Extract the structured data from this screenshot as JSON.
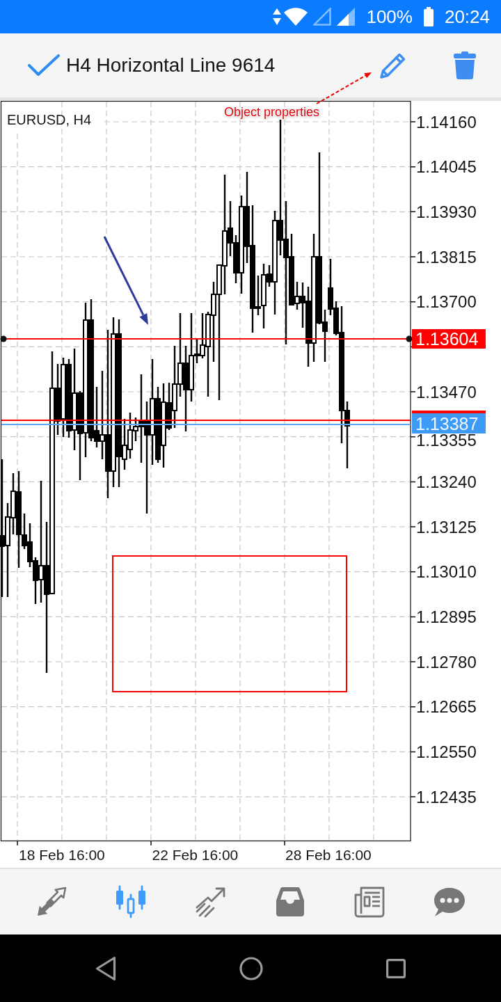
{
  "status_bar": {
    "battery": "100%",
    "time": "20:24"
  },
  "header": {
    "title": "H4 Horizontal Line 9614"
  },
  "callout": {
    "label": "Object properties"
  },
  "chart": {
    "symbol": "EURUSD, H4",
    "horizontal_line": {
      "selected": true
    },
    "price_labels": [
      "1.14160",
      "1.14045",
      "1.13930",
      "1.13815",
      "1.13700",
      "1.13470",
      "1.13355",
      "1.13240",
      "1.13125",
      "1.13010",
      "1.12895",
      "1.12780",
      "1.12665",
      "1.12550",
      "1.12435"
    ],
    "price_tags": [
      {
        "kind": "line",
        "text": "1.13604"
      },
      {
        "kind": "bid",
        "text": "1.13387"
      }
    ],
    "time_labels": [
      "18 Feb 16:00",
      "22 Feb 16:00",
      "28 Feb 16:00"
    ]
  },
  "bottom_nav": [
    {
      "kind": "quotes",
      "selected": false
    },
    {
      "kind": "chart",
      "selected": true
    },
    {
      "kind": "trade",
      "selected": false
    },
    {
      "kind": "history",
      "selected": false
    },
    {
      "kind": "news",
      "selected": false
    },
    {
      "kind": "messages",
      "selected": false
    }
  ]
}
